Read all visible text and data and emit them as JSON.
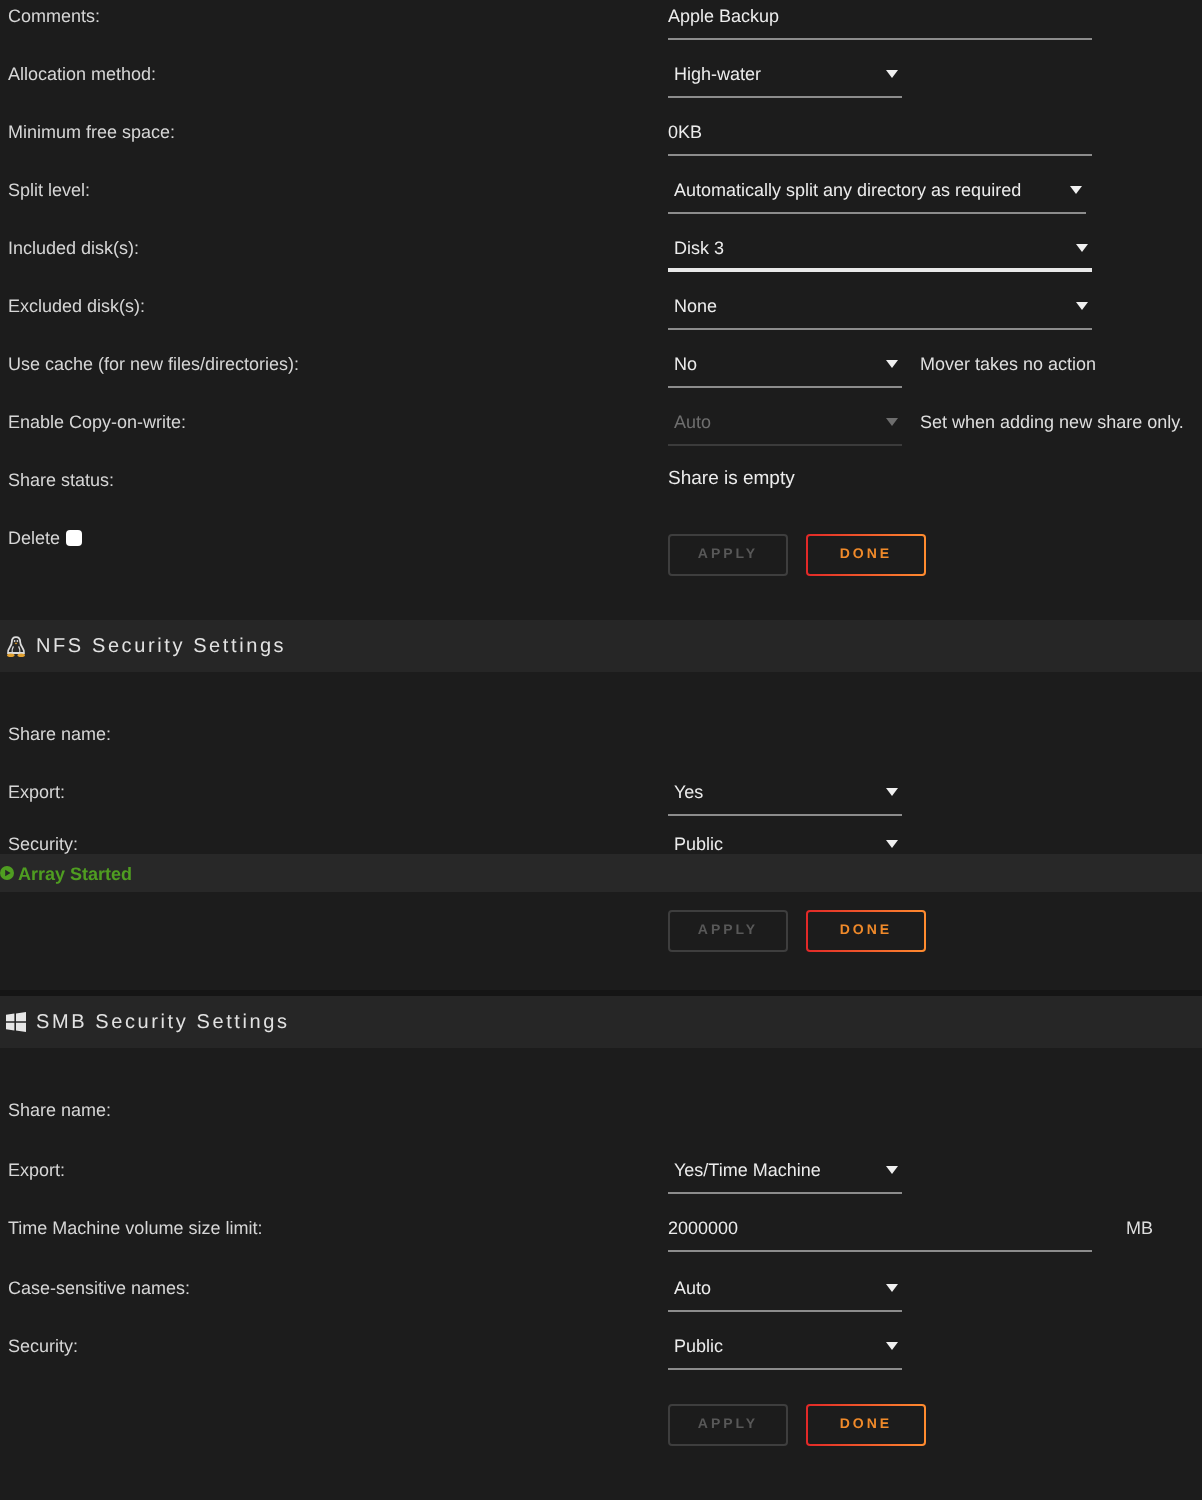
{
  "share_settings": {
    "rows": [
      {
        "label": "Comments:",
        "field": {
          "kind": "text",
          "value": "Apple Backup",
          "focused": false,
          "disabled": false
        }
      },
      {
        "label": "Allocation method:",
        "field": {
          "kind": "select",
          "value": "High-water",
          "focused": false,
          "disabled": false
        }
      },
      {
        "label": "Minimum free space:",
        "field": {
          "kind": "text",
          "value": "0KB",
          "focused": false,
          "disabled": false
        }
      },
      {
        "label": "Split level:",
        "field": {
          "kind": "select",
          "value": "Automatically split any directory as required",
          "focused": false,
          "disabled": false
        }
      },
      {
        "label": "Included disk(s):",
        "field": {
          "kind": "multiselect",
          "value": "Disk 3",
          "focused": true,
          "disabled": false
        }
      },
      {
        "label": "Excluded disk(s):",
        "field": {
          "kind": "multiselect",
          "value": "None",
          "focused": false,
          "disabled": false
        }
      },
      {
        "label": "Use cache (for new files/directories):",
        "field": {
          "kind": "select",
          "value": "No",
          "focused": false,
          "disabled": false
        },
        "note": "Mover takes no action"
      },
      {
        "label": "Enable Copy-on-write:",
        "field": {
          "kind": "select",
          "value": "Auto",
          "focused": false,
          "disabled": true
        },
        "note": "Set when adding new share only."
      },
      {
        "label": "Share status:",
        "field": {
          "kind": "static",
          "value": "Share is empty"
        }
      }
    ],
    "delete": {
      "label": "Delete",
      "checked": false
    },
    "buttons": [
      {
        "label": "APPLY",
        "disabled": true
      },
      {
        "label": "DONE",
        "disabled": false
      }
    ]
  },
  "nfs_security": {
    "title": "NFS Security Settings",
    "rows": [
      {
        "label": "Share name:"
      },
      {
        "label": "Export:",
        "field": {
          "kind": "select",
          "value": "Yes",
          "focused": false,
          "disabled": false
        }
      },
      {
        "label": "Security:",
        "field": {
          "kind": "select",
          "value": "Public",
          "disabled": false
        }
      }
    ],
    "buttons": [
      {
        "label": "APPLY",
        "disabled": true
      },
      {
        "label": "DONE",
        "disabled": false
      }
    ]
  },
  "status_bar": {
    "text": "Array Started"
  },
  "smb_security": {
    "title": "SMB Security Settings",
    "rows": [
      {
        "label": "Share name:"
      },
      {
        "label": "Export:",
        "field": {
          "kind": "select",
          "value": "Yes/Time Machine",
          "focused": false,
          "disabled": false
        }
      },
      {
        "label": "Time Machine volume size limit:",
        "field": {
          "kind": "text",
          "value": "2000000",
          "focused": false,
          "disabled": false
        },
        "unit": "MB"
      },
      {
        "label": "Case-sensitive names:",
        "field": {
          "kind": "select",
          "value": "Auto",
          "focused": false,
          "disabled": false
        }
      },
      {
        "label": "Security:",
        "field": {
          "kind": "select",
          "value": "Public",
          "focused": false,
          "disabled": false
        }
      }
    ],
    "buttons": [
      {
        "label": "APPLY",
        "disabled": true
      },
      {
        "label": "DONE",
        "disabled": false
      }
    ]
  }
}
